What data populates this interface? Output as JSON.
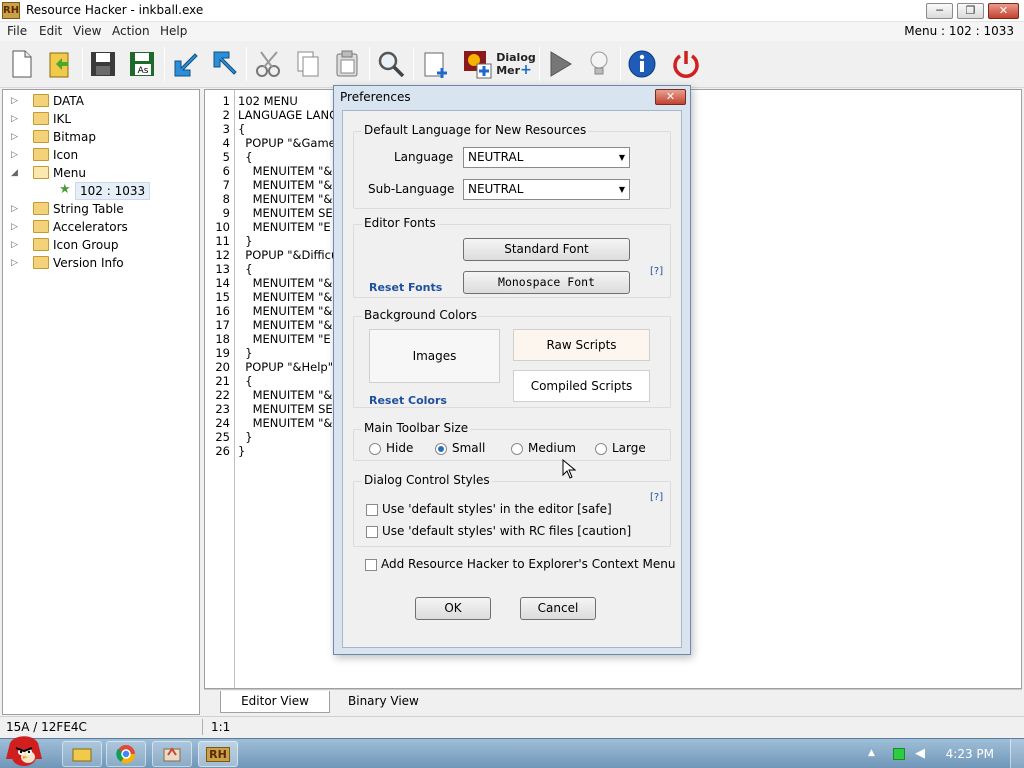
{
  "window": {
    "logo": "RH",
    "title": "Resource Hacker - inkball.exe",
    "minimize": "─",
    "maximize": "❐",
    "close": "✕"
  },
  "menu": {
    "items": [
      "File",
      "Edit",
      "View",
      "Action",
      "Help"
    ],
    "status": "Menu : 102 : 1033"
  },
  "toolbar": {
    "buttons": [
      "new-icon",
      "open-icon",
      "save-icon",
      "save-as-icon",
      "import-icon",
      "export-icon",
      "cut-icon",
      "copy-icon",
      "paste-icon",
      "find-icon",
      "add-resource-icon",
      "add-image-icon",
      "dialog-merge-icon",
      "run-script-icon",
      "hint-icon",
      "about-icon",
      "exit-icon"
    ],
    "save_as_label": "As",
    "dialog_merge_label_1": "Dialog",
    "dialog_merge_label_2": "Mer"
  },
  "tree": {
    "items": [
      {
        "label": "DATA"
      },
      {
        "label": "IKL"
      },
      {
        "label": "Bitmap"
      },
      {
        "label": "Icon"
      },
      {
        "label": "Menu"
      },
      {
        "label": "102 : 1033"
      },
      {
        "label": "String Table"
      },
      {
        "label": "Accelerators"
      },
      {
        "label": "Icon Group"
      },
      {
        "label": "Version Info"
      }
    ]
  },
  "editor": {
    "line_numbers": [
      "1",
      "2",
      "3",
      "4",
      "5",
      "6",
      "7",
      "8",
      "9",
      "10",
      "11",
      "12",
      "13",
      "14",
      "15",
      "16",
      "17",
      "18",
      "19",
      "20",
      "21",
      "22",
      "23",
      "24",
      "25",
      "26"
    ],
    "lines": [
      "102 MENU",
      "LANGUAGE LANG",
      "{",
      "  POPUP \"&Game",
      "  {",
      "    MENUITEM \"&",
      "    MENUITEM \"&",
      "    MENUITEM \"&",
      "    MENUITEM SE",
      "    MENUITEM \"E",
      "  }",
      "  POPUP \"&Difficu",
      "  {",
      "    MENUITEM \"&",
      "    MENUITEM \"&",
      "    MENUITEM \"&",
      "    MENUITEM \"&",
      "    MENUITEM \"E",
      "  }",
      "  POPUP \"&Help\"",
      "  {",
      "    MENUITEM \"&",
      "    MENUITEM SE",
      "    MENUITEM \"&",
      "  }",
      "}"
    ]
  },
  "tabs": [
    "Editor View",
    "Binary View"
  ],
  "status": {
    "left": "15A / 12FE4C",
    "position": "1:1"
  },
  "taskbar": {
    "clock": "4:23 PM"
  },
  "dialog": {
    "title": "Preferences",
    "close": "✕",
    "default_language": {
      "title": "Default Language for New Resources",
      "language_label": "Language",
      "language_value": "NEUTRAL",
      "sublanguage_label": "Sub-Language",
      "sublanguage_value": "NEUTRAL"
    },
    "editor_fonts": {
      "title": "Editor Fonts",
      "standard_font": "Standard Font",
      "monospace_font": "Monospace Font",
      "reset": "Reset Fonts",
      "help": "[?]"
    },
    "background_colors": {
      "title": "Background Colors",
      "images": "Images",
      "raw_scripts": "Raw Scripts",
      "compiled_scripts": "Compiled Scripts",
      "reset": "Reset Colors",
      "raw_scripts_color": "#fdf6ee",
      "compiled_scripts_color": "#ffffff"
    },
    "toolbar_size": {
      "title": "Main Toolbar Size",
      "options": [
        "Hide",
        "Small",
        "Medium",
        "Large"
      ],
      "selected": "Small"
    },
    "dialog_styles": {
      "title": "Dialog Control Styles",
      "help": "[?]",
      "option1": "Use 'default styles' in the editor  [safe]",
      "option2": "Use 'default styles' with RC files  [caution]",
      "option1_checked": false,
      "option2_checked": false
    },
    "context_menu": {
      "label": "Add Resource Hacker to Explorer's Context Menu",
      "checked": false
    },
    "ok": "OK",
    "cancel": "Cancel"
  },
  "colors": {
    "accent": "#2a6fbf",
    "dialog_frame": "#d8e4f0",
    "taskbar": "#7fa3c4"
  }
}
